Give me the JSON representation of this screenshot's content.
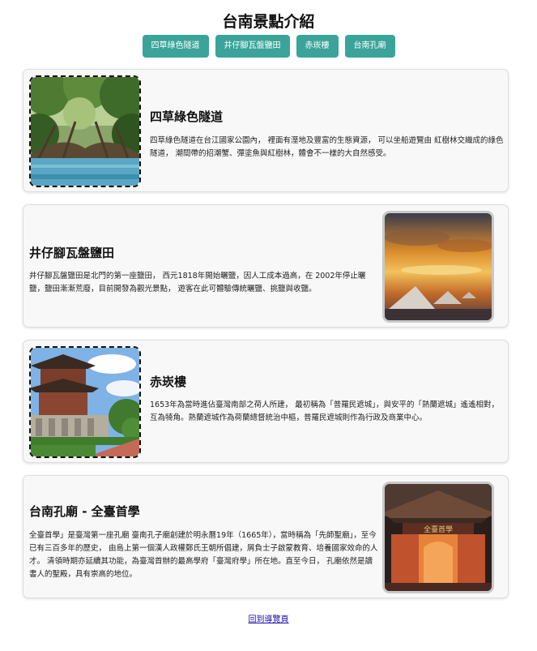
{
  "page": {
    "title": "台南景點介紹"
  },
  "nav": {
    "items": [
      {
        "label": "四草綠色隧道"
      },
      {
        "label": "井仔腳瓦盤鹽田"
      },
      {
        "label": "赤崁樓"
      },
      {
        "label": "台南孔廟"
      }
    ]
  },
  "attractions": [
    {
      "title": "四草綠色隧道",
      "description": "四草綠色隧道在台江國家公園內， 裡面有溼地及豐富的生態資源， 可以坐船遊覽由 紅樹林交織成的綠色隧道， 潮間帶的招潮蟹、彈塗魚與紅樹林，體會不一樣的大自然感受。"
    },
    {
      "title": "井仔腳瓦盤鹽田",
      "description": "井仔腳瓦盤鹽田是北門的第一座鹽田， 西元1818年開始曬鹽，因人工成本過高，在 2002年停止曬鹽，鹽田漸漸荒廢，目前開發為觀光景點， 遊客在此可體驗傳統曬鹽、挑鹽與收鹽。"
    },
    {
      "title": "赤崁樓",
      "description": "1653年為當時進佔臺灣南部之荷人所建， 最初稱為「普羅民遮城」，與安平的「熱蘭遮城」遙遙相對， 互為犄角。熱蘭遮城作為荷蘭總督統治中樞，普羅民遮城則作為行政及商業中心。"
    },
    {
      "title": "台南孔廟 - 全臺首學",
      "description": "全臺首學」是臺灣第一座孔廟 臺南孔子廟創建於明永曆19年（1665年），當時稱為「先師聖廟」，至今已有三百多年的歷史， 由島上第一個漢人政權鄭氏王朝所倡建，屑負士子啟蒙教育、培養國家效命的人才。 清領時期亦延續其功能，為臺灣首辦的最高學府「臺灣府學」所在地。直至今日， 孔廟依然是讀書人的聖殿，具有崇高的地位。",
      "gate_plaque": "全臺首學"
    }
  ],
  "footer": {
    "link_label": "回到導覽頁"
  }
}
